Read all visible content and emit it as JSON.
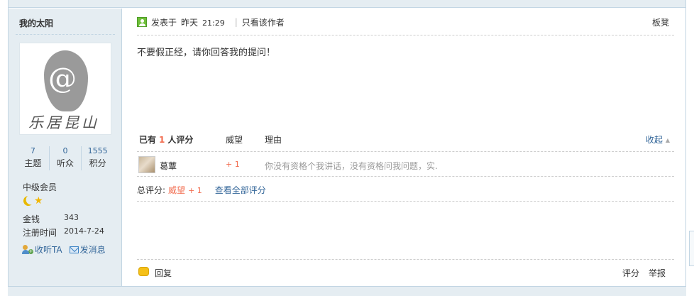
{
  "author": {
    "name": "我的太阳",
    "avatar_text": "乐居昆山",
    "stats": [
      {
        "value": "7",
        "label": "主题"
      },
      {
        "value": "0",
        "label": "听众"
      },
      {
        "value": "1555",
        "label": "积分"
      }
    ],
    "group": "中级会员",
    "info": [
      {
        "label": "金钱",
        "value": "343"
      },
      {
        "label": "注册时间",
        "value": "2014-7-24"
      }
    ],
    "follow_label": "收听TA",
    "message_label": "发消息"
  },
  "post": {
    "posted_prefix": "发表于",
    "posted_day": "昨天",
    "posted_time": "21:29",
    "only_author": "只看该作者",
    "floor": "板凳",
    "body": "不要假正经，请你回答我的提问！"
  },
  "rating": {
    "title_prefix": "已有",
    "count": "1",
    "title_suffix": "人评分",
    "col_weiwang": "威望",
    "col_reason": "理由",
    "collapse": "收起",
    "rows": [
      {
        "user": "葛蕈",
        "score": "+ 1",
        "reason": "你没有资格个我讲话，没有资格问我问题，实."
      }
    ],
    "total_label": "总评分:",
    "total_value_label": "威望",
    "total_value": "+ 1",
    "view_all": "查看全部评分"
  },
  "footer": {
    "reply": "回复",
    "rate": "评分",
    "report": "举报"
  },
  "colors": {
    "sidebar_bg": "#e5edf2",
    "border": "#c2d5e3",
    "link": "#336699",
    "accent": "#f26c4f"
  }
}
